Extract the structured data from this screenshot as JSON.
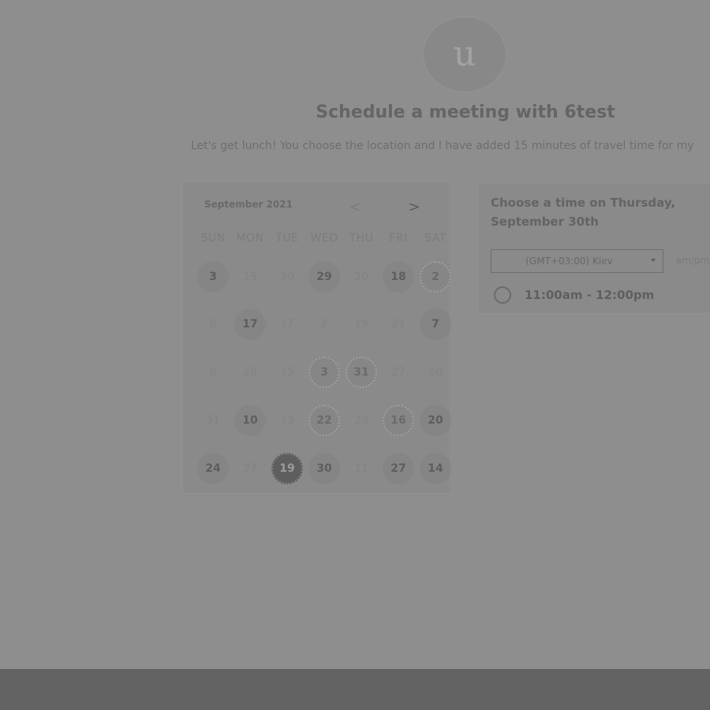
{
  "header": {
    "avatar_letter": "u",
    "title": "Schedule a meeting with 6test",
    "subtitle": "Let's get lunch! You choose the location and I have added 15 minutes of travel time for my"
  },
  "calendar": {
    "month_label": "September 2021",
    "prev_icon": "chevron-left-icon",
    "next_icon": "chevron-right-icon",
    "prev_glyph": "<",
    "next_glyph": ">",
    "weekdays": [
      "SUN",
      "MON",
      "TUE",
      "WED",
      "THU",
      "FRI",
      "SAT"
    ],
    "weeks": [
      [
        {
          "label": "3",
          "state": "available"
        },
        {
          "label": "15",
          "state": "faded"
        },
        {
          "label": "30",
          "state": "faded"
        },
        {
          "label": "29",
          "state": "available"
        },
        {
          "label": "20",
          "state": "faded"
        },
        {
          "label": "18",
          "state": "available"
        },
        {
          "label": "2",
          "state": "sparkle"
        }
      ],
      [
        {
          "label": "8",
          "state": "faded"
        },
        {
          "label": "17",
          "state": "available"
        },
        {
          "label": "17",
          "state": "faded"
        },
        {
          "label": "2",
          "state": "faded"
        },
        {
          "label": "19",
          "state": "faded"
        },
        {
          "label": "21",
          "state": "faded"
        },
        {
          "label": "7",
          "state": "available"
        }
      ],
      [
        {
          "label": "6",
          "state": "faded"
        },
        {
          "label": "28",
          "state": "faded"
        },
        {
          "label": "15",
          "state": "faded"
        },
        {
          "label": "3",
          "state": "sparkle"
        },
        {
          "label": "31",
          "state": "sparkle"
        },
        {
          "label": "27",
          "state": "faded"
        },
        {
          "label": "10",
          "state": "faded"
        }
      ],
      [
        {
          "label": "31",
          "state": "faded"
        },
        {
          "label": "10",
          "state": "available"
        },
        {
          "label": "13",
          "state": "faded"
        },
        {
          "label": "22",
          "state": "sparkle"
        },
        {
          "label": "23",
          "state": "faded"
        },
        {
          "label": "16",
          "state": "sparkle"
        },
        {
          "label": "20",
          "state": "available"
        }
      ],
      [
        {
          "label": "24",
          "state": "available"
        },
        {
          "label": "27",
          "state": "faded"
        },
        {
          "label": "19",
          "state": "selected"
        },
        {
          "label": "30",
          "state": "available"
        },
        {
          "label": "11",
          "state": "faded"
        },
        {
          "label": "27",
          "state": "available"
        },
        {
          "label": "14",
          "state": "available"
        }
      ]
    ]
  },
  "time_panel": {
    "heading": "Choose a time on Thursday, September 30th",
    "timezone": "(GMT+03:00) Kiev",
    "format_toggle": "am/pm",
    "slots": [
      {
        "label": "11:00am - 12:00pm"
      }
    ]
  }
}
